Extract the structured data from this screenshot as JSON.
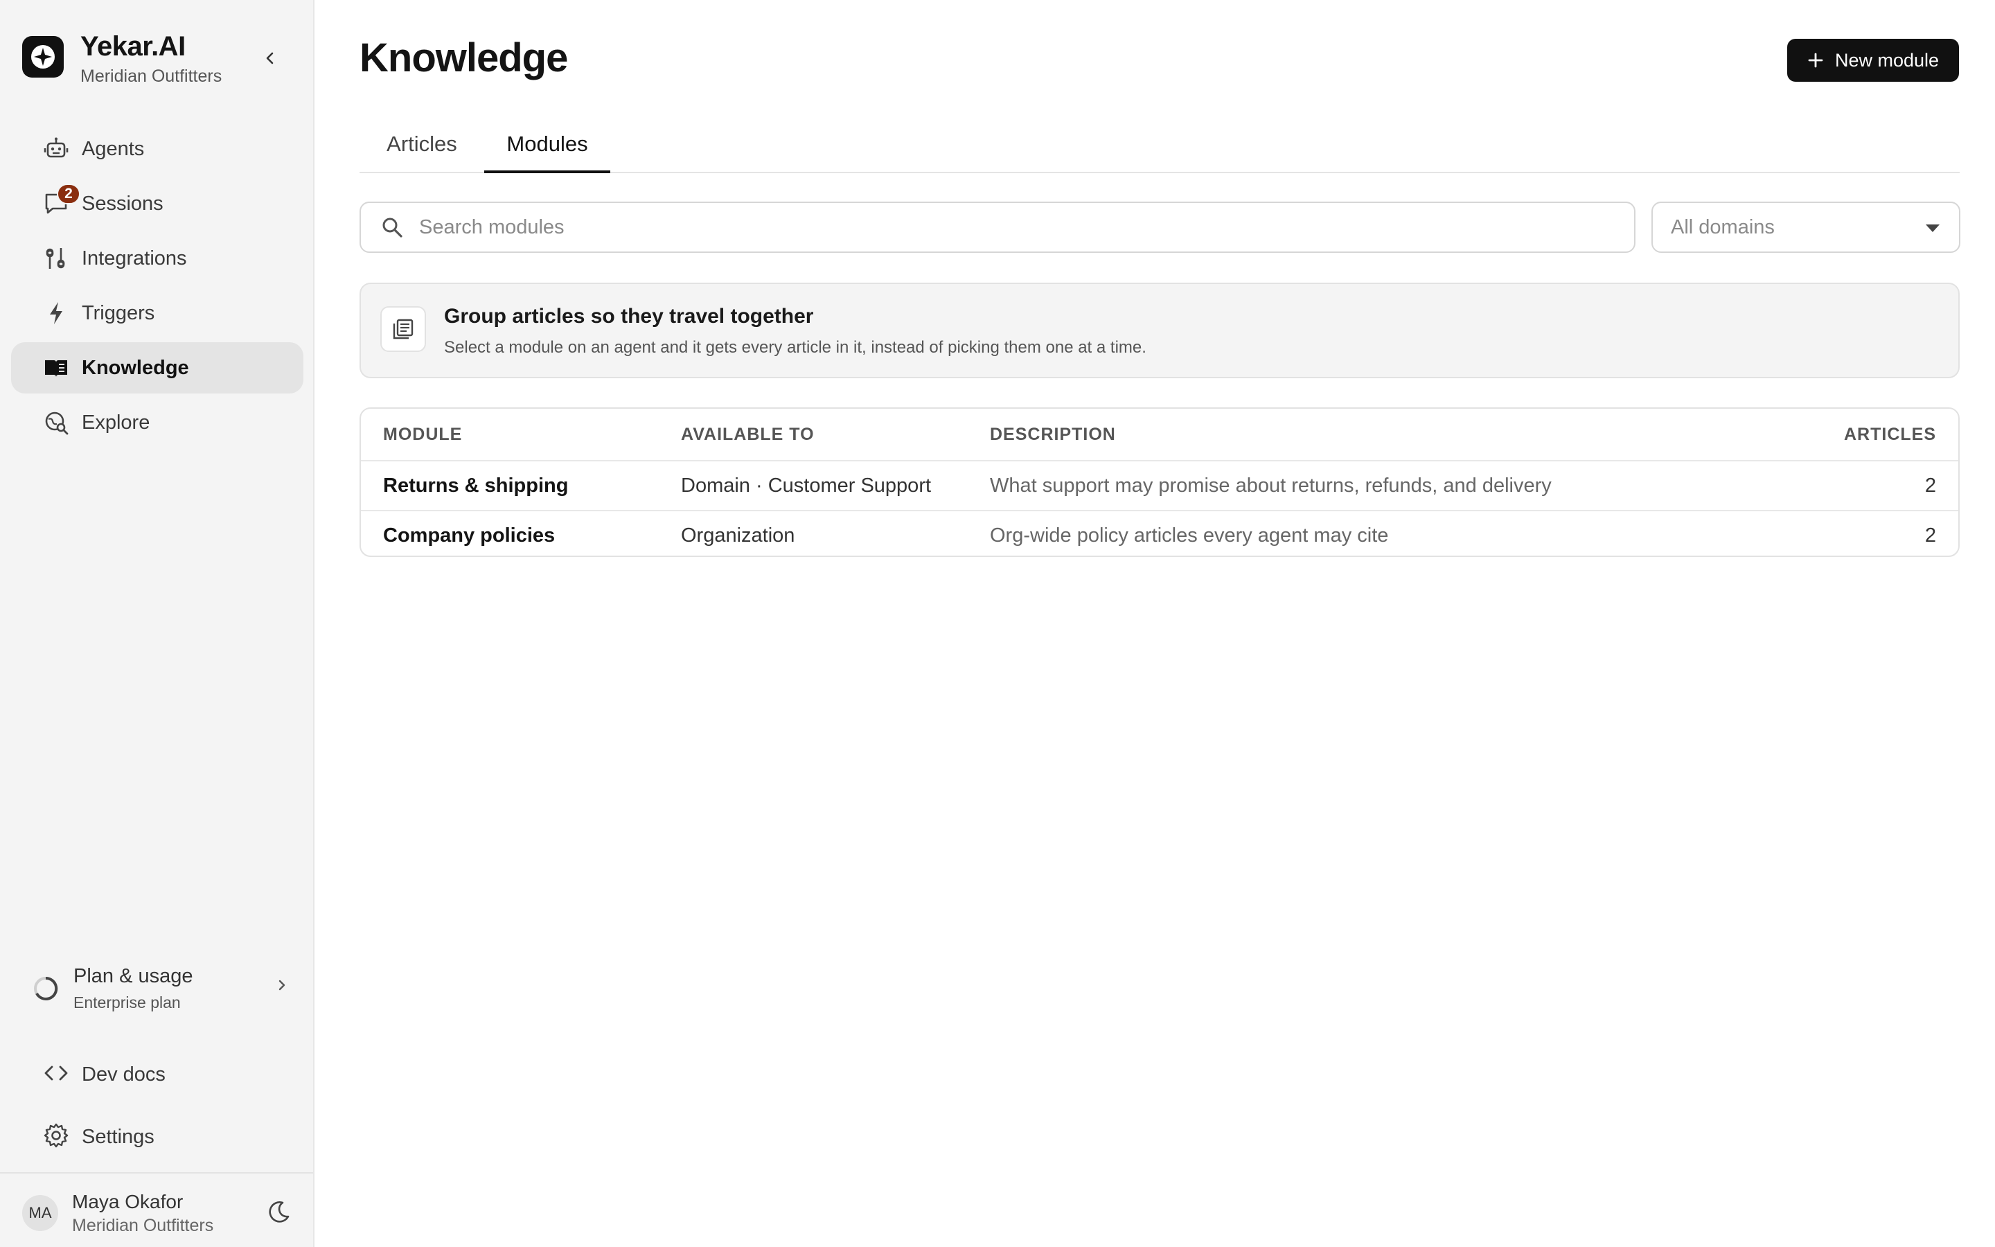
{
  "brand": {
    "name": "Yekar.AI",
    "org": "Meridian Outfitters"
  },
  "sidebar": {
    "items": [
      {
        "label": "Agents",
        "icon": "robot-icon"
      },
      {
        "label": "Sessions",
        "icon": "chat-icon",
        "badge": "2"
      },
      {
        "label": "Integrations",
        "icon": "integrations-icon"
      },
      {
        "label": "Triggers",
        "icon": "lightning-icon"
      },
      {
        "label": "Knowledge",
        "icon": "book-icon",
        "active": true
      },
      {
        "label": "Explore",
        "icon": "explore-icon"
      }
    ],
    "plan": {
      "title": "Plan & usage",
      "subtitle": "Enterprise plan"
    },
    "dev_docs": "Dev docs",
    "settings": "Settings",
    "user": {
      "initials": "MA",
      "name": "Maya Okafor",
      "org": "Meridian Outfitters"
    }
  },
  "header": {
    "title": "Knowledge",
    "new_button": "New module"
  },
  "tabs": [
    {
      "label": "Articles",
      "active": false
    },
    {
      "label": "Modules",
      "active": true
    }
  ],
  "filters": {
    "search_placeholder": "Search modules",
    "domain_select": "All domains"
  },
  "info": {
    "title": "Group articles so they travel together",
    "description": "Select a module on an agent and it gets every article in it, instead of picking them one at a time."
  },
  "table": {
    "columns": [
      "MODULE",
      "AVAILABLE TO",
      "DESCRIPTION",
      "ARTICLES"
    ],
    "rows": [
      {
        "module": "Returns & shipping",
        "available_to": "Domain · Customer Support",
        "description": "What support may promise about returns, refunds, and delivery",
        "articles": "2"
      },
      {
        "module": "Company policies",
        "available_to": "Organization",
        "description": "Org-wide policy articles every agent may cite",
        "articles": "2"
      }
    ]
  },
  "colors": {
    "accent": "#111111",
    "badge": "#8a2e0f",
    "sidebar_bg": "#f4f4f4",
    "active_nav": "#e4e4e4"
  }
}
